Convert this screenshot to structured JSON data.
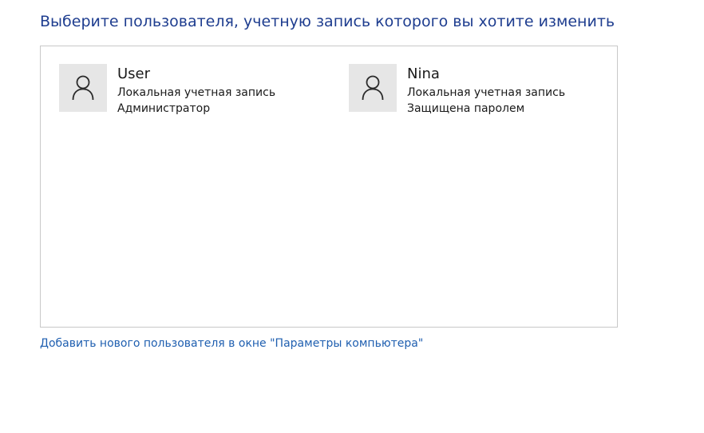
{
  "page": {
    "title": "Выберите пользователя, учетную запись которого вы хотите изменить"
  },
  "accounts": [
    {
      "name": "User",
      "type": "Локальная учетная запись",
      "status": "Администратор",
      "icon": "user-icon"
    },
    {
      "name": "Nina",
      "type": "Локальная учетная запись",
      "status": "Защищена паролем",
      "icon": "user-icon"
    }
  ],
  "links": {
    "add_user": "Добавить нового пользователя в окне \"Параметры компьютера\""
  },
  "colors": {
    "title": "#1e3d8f",
    "link": "#1f5fb0",
    "avatar_bg": "#e6e6e6",
    "border": "#c8c8c8"
  }
}
